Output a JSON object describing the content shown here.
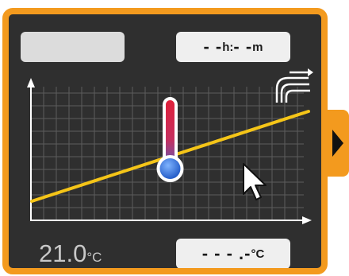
{
  "timer": {
    "hours_placeholder": "- -",
    "hours_unit": "h:",
    "minutes_placeholder": "- -",
    "minutes_unit": "m"
  },
  "current_temperature": {
    "value": "21.0",
    "unit": "°C"
  },
  "setpoint": {
    "placeholder": "- - - .-",
    "unit": "°C"
  },
  "graph": {
    "line_color": "#f5c518"
  },
  "icons": {
    "thermometer": "thermometer-icon",
    "mode": "heating-curve-mode-icon",
    "next": "next-arrow-icon",
    "cursor": "mouse-pointer-icon"
  },
  "colors": {
    "frame": "#f39a1e",
    "panel": "#2f2f2f",
    "grid": "#5c5c5c",
    "axis": "#ffffff"
  }
}
